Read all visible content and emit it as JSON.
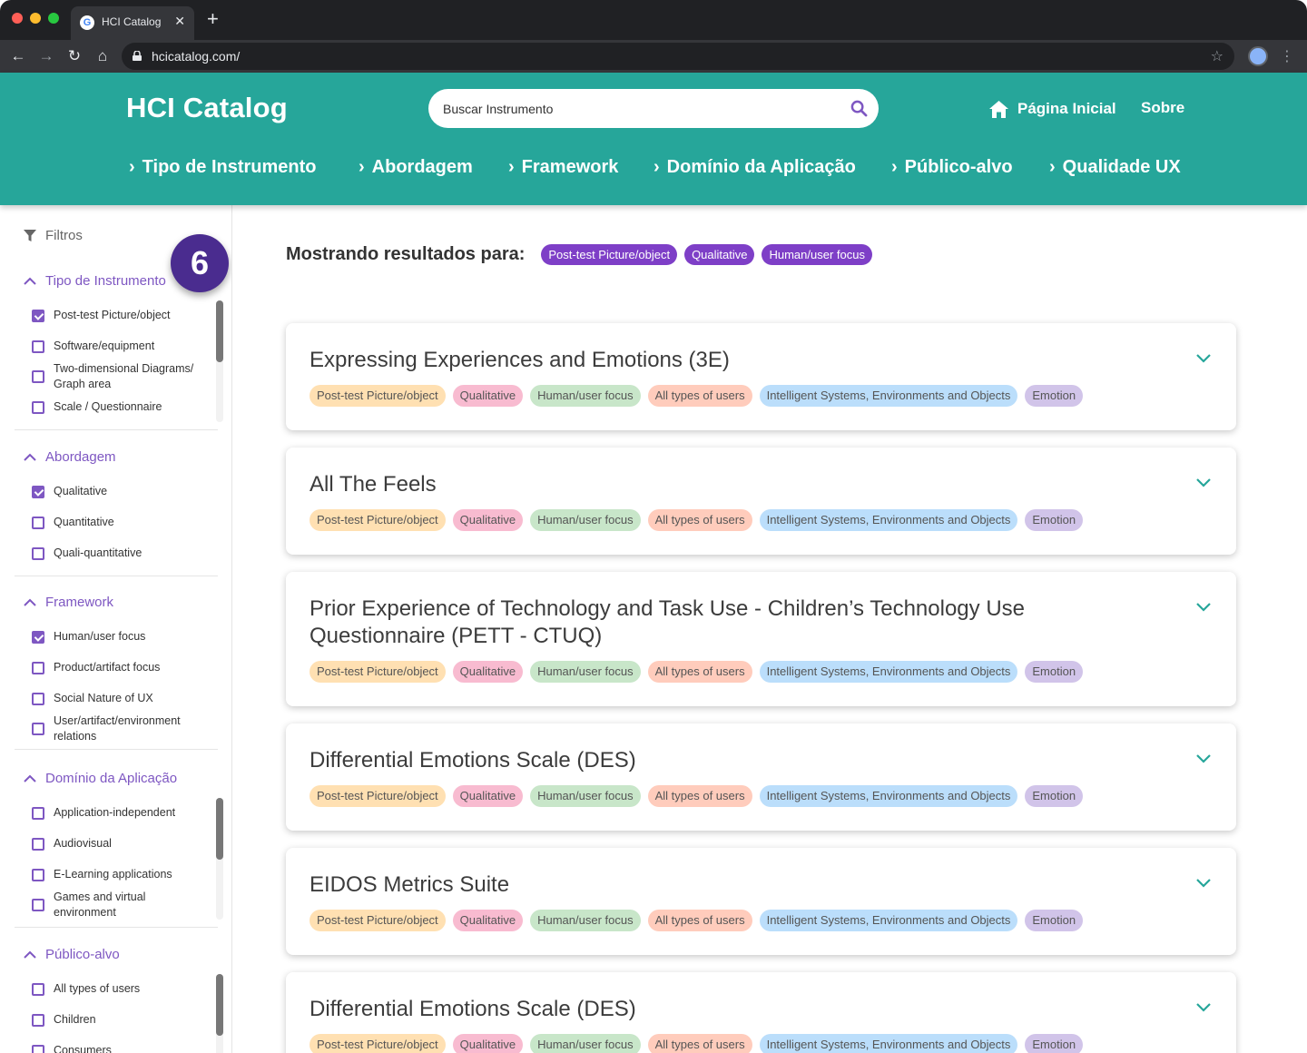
{
  "browser": {
    "tab_title": "HCI Catalog",
    "url": "hcicatalog.com/"
  },
  "header": {
    "brand": "HCI Catalog",
    "search_placeholder": "Buscar Instrumento",
    "home_label": "Página Inicial",
    "about_label": "Sobre",
    "nav": [
      {
        "label": "Tipo de Instrumento"
      },
      {
        "label": "Abordagem"
      },
      {
        "label": "Framework"
      },
      {
        "label": "Domínio da Aplicação"
      },
      {
        "label": "Público-alvo"
      },
      {
        "label": "Qualidade UX"
      }
    ]
  },
  "sidebar": {
    "filters_label": "Filtros",
    "step_badge": "6",
    "sections": [
      {
        "title": "Tipo de Instrumento",
        "options": [
          {
            "label": "Post-test Picture/object",
            "checked": true
          },
          {
            "label": "Software/equipment",
            "checked": false
          },
          {
            "label": "Two-dimensional Diagrams/ Graph area",
            "checked": false
          },
          {
            "label": "Scale / Questionnaire",
            "checked": false
          }
        ]
      },
      {
        "title": "Abordagem",
        "options": [
          {
            "label": "Qualitative",
            "checked": true
          },
          {
            "label": "Quantitative",
            "checked": false
          },
          {
            "label": "Quali-quantitative",
            "checked": false
          }
        ]
      },
      {
        "title": "Framework",
        "options": [
          {
            "label": "Human/user focus",
            "checked": true
          },
          {
            "label": "Product/artifact focus",
            "checked": false
          },
          {
            "label": "Social Nature of UX",
            "checked": false
          },
          {
            "label": "User/artifact/environment relations",
            "checked": false
          }
        ]
      },
      {
        "title": "Domínio da Aplicação",
        "options": [
          {
            "label": "Application-independent",
            "checked": false
          },
          {
            "label": "Audiovisual",
            "checked": false
          },
          {
            "label": "E-Learning applications",
            "checked": false
          },
          {
            "label": "Games and virtual environment",
            "checked": false
          }
        ]
      },
      {
        "title": "Público-alvo",
        "options": [
          {
            "label": "All types of users",
            "checked": false
          },
          {
            "label": "Children",
            "checked": false
          },
          {
            "label": "Consumers",
            "checked": false
          }
        ]
      }
    ]
  },
  "main": {
    "results_label": "Mostrando resultados para:",
    "active_filters": [
      "Post-test Picture/object",
      "Qualitative",
      "Human/user focus"
    ],
    "tags": [
      "Post-test Picture/object",
      "Qualitative",
      "Human/user focus",
      "All types of users",
      "Intelligent Systems, Environments and Objects",
      "Emotion"
    ],
    "cards": [
      {
        "title": "Expressing Experiences and Emotions (3E)"
      },
      {
        "title": "All The Feels"
      },
      {
        "title": "Prior Experience of Technology and Task Use - Children’s Technology Use Questionnaire (PETT - CTUQ)"
      },
      {
        "title": "Differential Emotions Scale (DES)"
      },
      {
        "title": "EIDOS Metrics Suite"
      },
      {
        "title": "Differential Emotions Scale (DES)"
      }
    ]
  },
  "colors": {
    "header_teal": "#26a69a",
    "accent_purple": "#7e57c2",
    "chip_purple": "#7e3fc7"
  }
}
